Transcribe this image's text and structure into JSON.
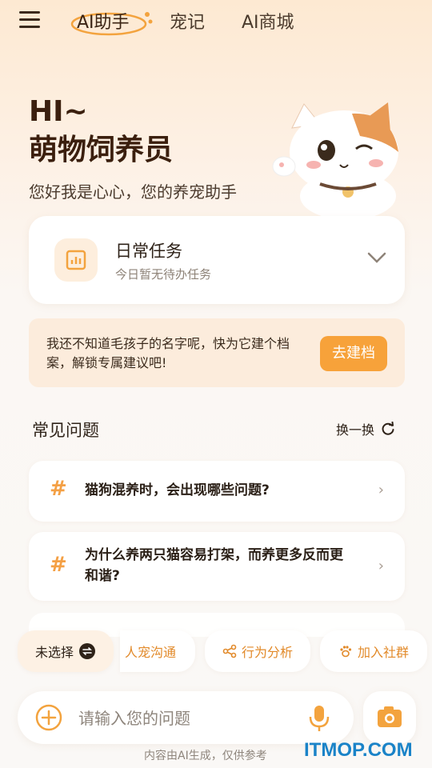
{
  "nav": {
    "tabs": [
      {
        "label": "AI助手",
        "active": true
      },
      {
        "label": "宠记",
        "active": false
      },
      {
        "label": "AI商城",
        "active": false
      }
    ]
  },
  "hero": {
    "greeting": "HI~",
    "title": "萌物饲养员",
    "subtitle": "您好我是心心，您的养宠助手"
  },
  "daily_task": {
    "title": "日常任务",
    "subtitle": "今日暂无待办任务"
  },
  "banner": {
    "text": "我还不知道毛孩子的名字呢，快为它建个档案，解锁专属建议吧!",
    "button_label": "去建档"
  },
  "faq": {
    "title": "常见问题",
    "refresh_label": "换一换",
    "items": [
      {
        "text": "猫狗混养时，会出现哪些问题?"
      },
      {
        "text": "为什么养两只猫容易打架，而养更多反而更和谐?"
      }
    ]
  },
  "chips": {
    "select_label": "未选择",
    "items": [
      "人宠沟通",
      "行为分析",
      "加入社群"
    ]
  },
  "input": {
    "placeholder": "请输入您的问题"
  },
  "disclaimer": "内容由AI生成，仅供参考",
  "watermark": "ITMOP.COM",
  "colors": {
    "accent": "#f7a23a",
    "hash": "#f4a045",
    "title": "#3b1f0e"
  }
}
